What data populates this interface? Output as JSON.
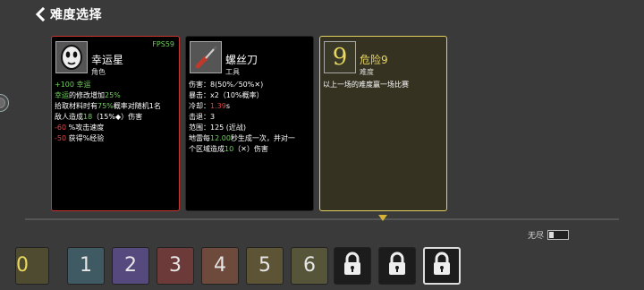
{
  "header": {
    "title": "难度选择",
    "back_icon": "chevron-left-icon"
  },
  "character_card": {
    "name": "幸运星",
    "type": "角色",
    "fps": "FPS59",
    "icon": "potato-face-icon",
    "lines": [
      [
        {
          "t": "+100 幸运",
          "c": "g"
        }
      ],
      [
        {
          "t": "幸运",
          "c": "g"
        },
        {
          "t": "的修改增加"
        },
        {
          "t": "25%",
          "c": "g"
        }
      ],
      [
        {
          "t": "拾取材料时有"
        },
        {
          "t": "75%",
          "c": "g"
        },
        {
          "t": "概率对随机1名"
        }
      ],
      [
        {
          "t": "敌人造成"
        },
        {
          "t": "18",
          "c": "g"
        },
        {
          "t": "（15%"
        },
        {
          "t": "◆"
        },
        {
          "t": "）伤害"
        }
      ],
      [
        {
          "t": "-60",
          "c": "r"
        },
        {
          "t": " %攻击速度"
        }
      ],
      [
        {
          "t": "-50",
          "c": "r"
        },
        {
          "t": " 获得%经验"
        }
      ]
    ]
  },
  "weapon_card": {
    "name": "螺丝刀",
    "type": "工具",
    "icon": "screwdriver-icon",
    "lines": [
      [
        {
          "t": "伤害：8(50%⟋50%✕)"
        }
      ],
      [
        {
          "t": "暴击：x2（10%概率）"
        }
      ],
      [
        {
          "t": "冷却："
        },
        {
          "t": "1.39",
          "c": "r"
        },
        {
          "t": "s"
        }
      ],
      [
        {
          "t": "击退：3"
        }
      ],
      [
        {
          "t": "范围：125 (近战)"
        }
      ],
      [
        {
          "t": "地雷每"
        },
        {
          "t": "12.00",
          "c": "g"
        },
        {
          "t": "秒生成一次，并对一"
        }
      ],
      [
        {
          "t": "个区域造成"
        },
        {
          "t": "10",
          "c": "g"
        },
        {
          "t": "（✕）伤害"
        }
      ]
    ]
  },
  "difficulty_card": {
    "name": "危险9",
    "type": "难度",
    "icon_digit": "9",
    "lines": [
      [
        {
          "t": "以上一场的难度赢一场比赛"
        }
      ]
    ]
  },
  "endless": {
    "label": "无尽",
    "enabled": false
  },
  "slots": [
    {
      "label": "0",
      "bg": "#4e4b30",
      "fg": "#e8d860",
      "locked": false
    },
    {
      "label": "1",
      "bg": "#3f5a63",
      "fg": "#e6e6e6",
      "locked": false
    },
    {
      "label": "2",
      "bg": "#55497e",
      "fg": "#e6e6e6",
      "locked": false
    },
    {
      "label": "3",
      "bg": "#6d3a3a",
      "fg": "#e6e6e6",
      "locked": false
    },
    {
      "label": "4",
      "bg": "#6e4a3c",
      "fg": "#e6e6e6",
      "locked": false
    },
    {
      "label": "5",
      "bg": "#5c5434",
      "fg": "#e6e6e6",
      "locked": false
    },
    {
      "label": "6",
      "bg": "#56553a",
      "fg": "#e6e6e6",
      "locked": false
    },
    {
      "label": "",
      "bg": "#1c1c1c",
      "fg": "#ffffff",
      "locked": true
    },
    {
      "label": "",
      "bg": "#1c1c1c",
      "fg": "#ffffff",
      "locked": true
    },
    {
      "label": "",
      "bg": "#1c1c1c",
      "fg": "#ffffff",
      "locked": true,
      "selected": true
    }
  ],
  "colors": {
    "positive": "#6fd25a",
    "negative": "#e04545",
    "selected_border": "#c8342e",
    "difficulty_border": "#e0d060"
  }
}
